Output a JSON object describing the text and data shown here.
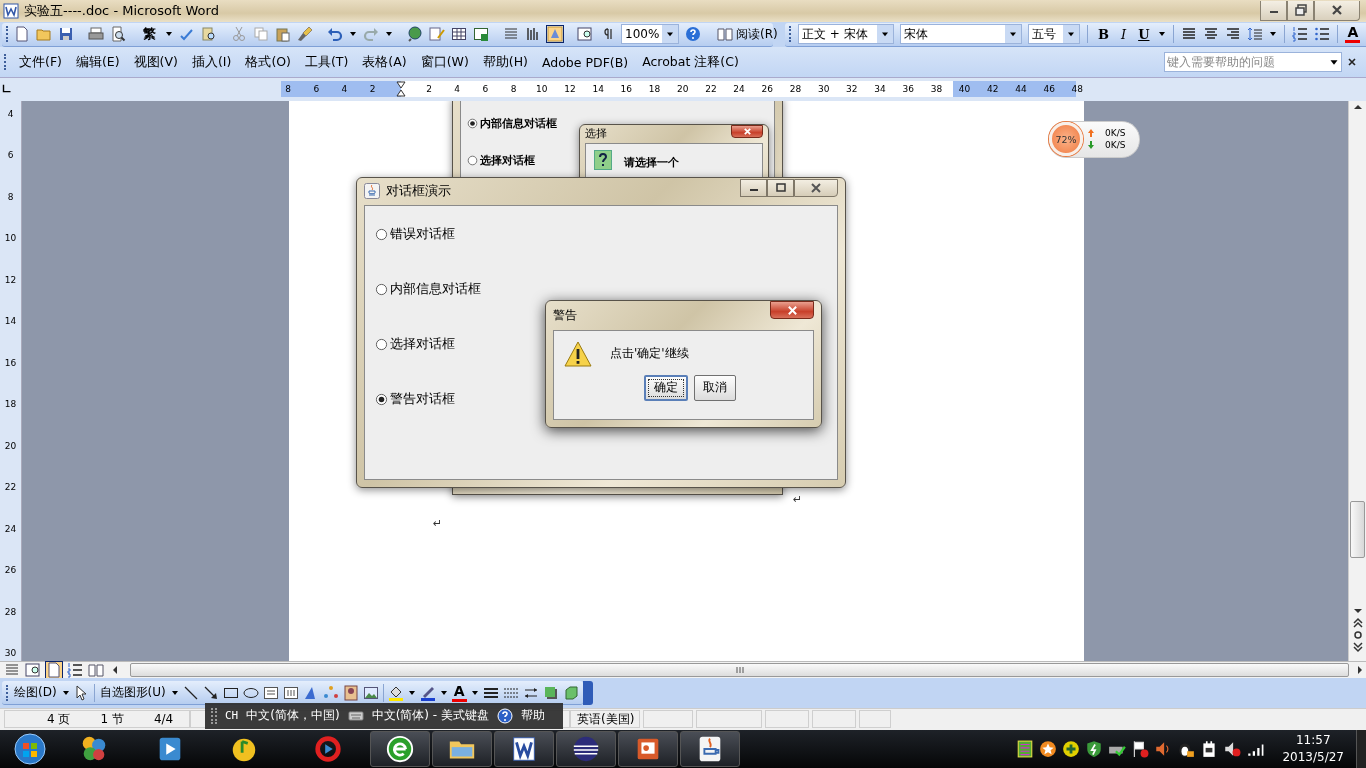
{
  "window": {
    "title": "实验五----.doc - Microsoft Word"
  },
  "standard_toolbar": {
    "traditional_button": "繁",
    "zoom": "100%",
    "read_button": "阅读(R)"
  },
  "formatting_toolbar": {
    "style": "正文 + 宋体",
    "font": "宋体",
    "size": "五号",
    "text_style_buttons": [
      "B",
      "I",
      "U"
    ],
    "font_color_button": "A"
  },
  "menu": [
    {
      "label": "文件(F)"
    },
    {
      "label": "编辑(E)"
    },
    {
      "label": "视图(V)"
    },
    {
      "label": "插入(I)"
    },
    {
      "label": "格式(O)"
    },
    {
      "label": "工具(T)"
    },
    {
      "label": "表格(A)"
    },
    {
      "label": "窗口(W)"
    },
    {
      "label": "帮助(H)"
    },
    {
      "label": "Adobe PDF(B)"
    },
    {
      "label": "Acrobat 注释(C)"
    }
  ],
  "help_search": {
    "placeholder": "键入需要帮助的问题"
  },
  "ruler": {
    "left_ticks": [
      "8",
      "6",
      "4",
      "2"
    ],
    "ticks": [
      "2",
      "4",
      "6",
      "8",
      "10",
      "12",
      "14",
      "16",
      "18",
      "20",
      "22",
      "24",
      "26",
      "28",
      "30",
      "32",
      "34",
      "36",
      "38",
      "40",
      "42",
      "44",
      "46",
      "48"
    ]
  },
  "vertical_ruler": {
    "ticks": [
      "4",
      "6",
      "8",
      "10",
      "12",
      "14",
      "16",
      "18",
      "20",
      "22",
      "24",
      "26",
      "28",
      "30"
    ]
  },
  "document": {
    "background_dialog": {
      "options": [
        {
          "label": "内部信息对话框",
          "selected": true
        },
        {
          "label": "选择对话框",
          "selected": false
        }
      ]
    },
    "choice_dialog": {
      "title": "选择",
      "message": "请选择一个"
    },
    "demo_dialog": {
      "title": "对话框演示",
      "options": [
        {
          "label": "错误对话框",
          "selected": false
        },
        {
          "label": "内部信息对话框",
          "selected": false
        },
        {
          "label": "选择对话框",
          "selected": false
        },
        {
          "label": "警告对话框",
          "selected": true
        }
      ]
    },
    "warning_dialog": {
      "title": "警告",
      "message": "点击'确定'继续",
      "buttons": [
        {
          "label": "确定",
          "focused": true
        },
        {
          "label": "取消",
          "focused": false
        }
      ]
    },
    "paragraph_marks": [
      "↵",
      "↵"
    ]
  },
  "net_monitor": {
    "usage": "72%",
    "upload": "0K/S",
    "download": "0K/S"
  },
  "drawing_toolbar": {
    "draw_menu": "绘图(D)",
    "autoshapes_menu": "自选图形(U)",
    "font_color_button": "A"
  },
  "status_bar": {
    "page": "4 页",
    "section": "1 节",
    "page_count": "4/4",
    "language": "英语(美国)"
  },
  "language_bar": {
    "code": "CH",
    "input_language": "中文(简体，中国)",
    "keyboard": "中文(简体) - 美式键盘",
    "help": "帮助"
  },
  "taskbar": {
    "time": "11:57",
    "date": "2013/5/27"
  }
}
